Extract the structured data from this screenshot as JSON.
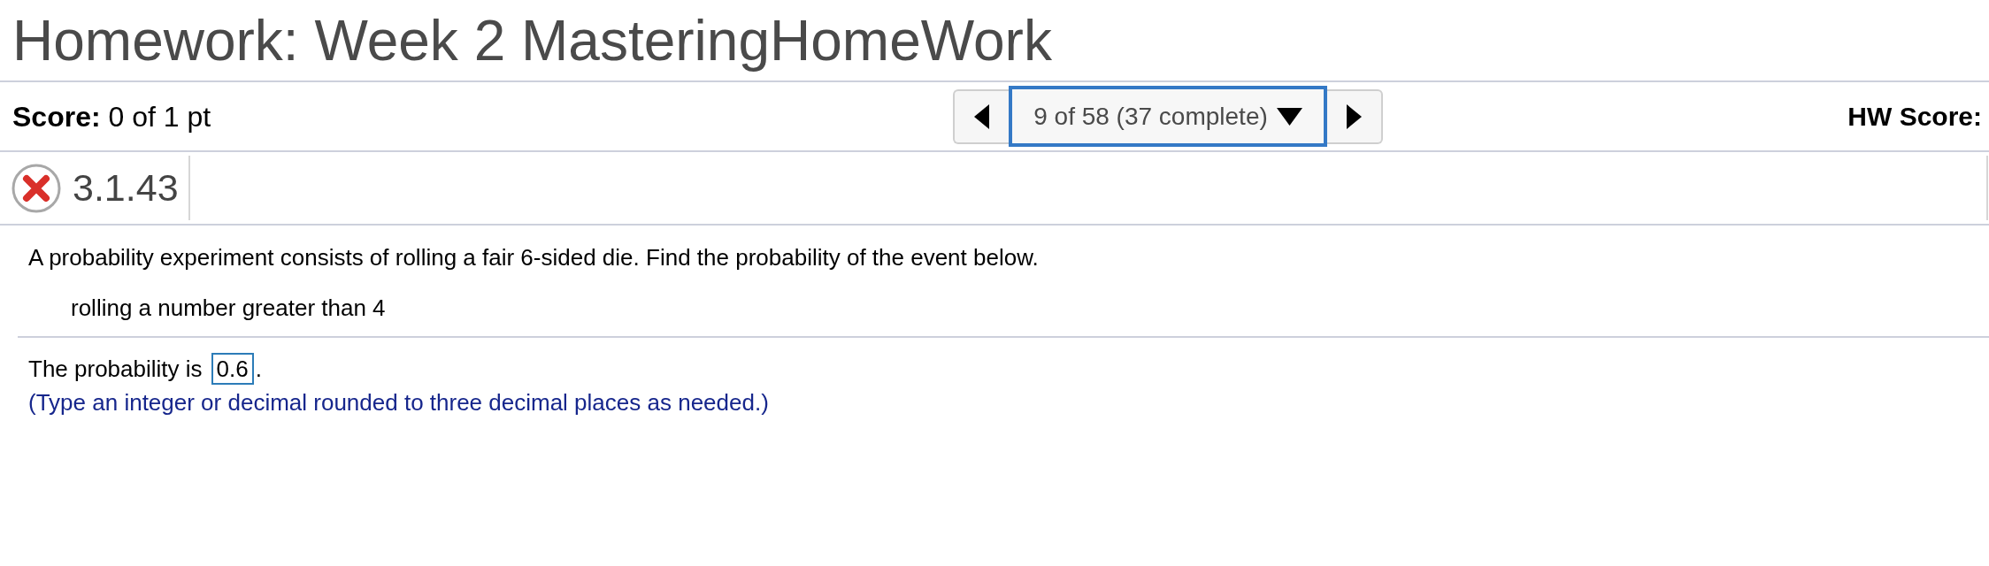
{
  "header": {
    "title": "Homework: Week 2 MasteringHomeWork"
  },
  "score_bar": {
    "score": "**Score:** 0 of 1 pt",
    "navigator": {
      "position": "9 of 58 (37 complete)"
    },
    "hw_score_label": "HW Score:"
  },
  "question": {
    "correct": false,
    "number": "3.1.43"
  },
  "problem": {
    "statement": "A probability experiment consists of rolling a fair 6-sided die. Find the probability of the event below.",
    "event": "rolling a number greater than 4"
  },
  "answer": {
    "prompt": "The probability is",
    "value": "0.6",
    "suffix": ".",
    "hint": "(Type an integer or decimal rounded to three decimal places as needed.)"
  }
}
